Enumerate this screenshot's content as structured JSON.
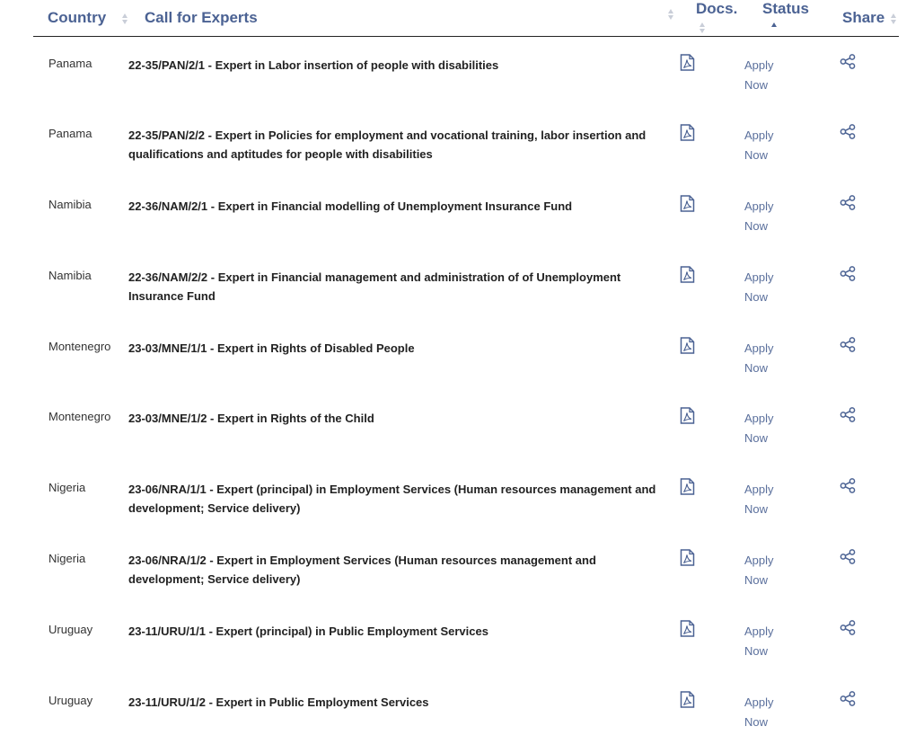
{
  "header": {
    "country": "Country",
    "call": "Call for Experts",
    "docs": "Docs.",
    "status": "Status",
    "share": "Share"
  },
  "colors": {
    "header": "#4b6293",
    "link": "#5a6f9c",
    "icon": "#4b6293"
  },
  "icons": {
    "doc": "pdf-file-icon",
    "share": "share-icon"
  },
  "rows": [
    {
      "country": "Panama",
      "call": "22-35/PAN/2/1 - Expert in Labor insertion of people with disabilities",
      "status": "Apply Now"
    },
    {
      "country": "Panama",
      "call": "22-35/PAN/2/2 - Expert in Policies for employment and vocational training, labor insertion and qualifications and aptitudes for people with disabilities",
      "status": "Apply Now"
    },
    {
      "country": "Namibia",
      "call": "22-36/NAM/2/1 - Expert in Financial modelling of Unemployment Insurance Fund",
      "status": "Apply Now"
    },
    {
      "country": "Namibia",
      "call": "22-36/NAM/2/2 - Expert in Financial management and administration of of Unemployment Insurance Fund",
      "status": "Apply Now"
    },
    {
      "country": "Montenegro",
      "call": "23-03/MNE/1/1 - Expert in Rights of Disabled People",
      "status": "Apply Now"
    },
    {
      "country": "Montenegro",
      "call": "23-03/MNE/1/2 - Expert in Rights of the Child",
      "status": "Apply Now"
    },
    {
      "country": "Nigeria",
      "call": "23-06/NRA/1/1 - Expert (principal) in Employment Services (Human resources management and development; Service delivery)",
      "status": "Apply Now"
    },
    {
      "country": "Nigeria",
      "call": "23-06/NRA/1/2 - Expert in Employment Services (Human resources management and development; Service delivery)",
      "status": "Apply Now"
    },
    {
      "country": "Uruguay",
      "call": "23-11/URU/1/1 - Expert (principal) in Public Employment Services",
      "status": "Apply Now"
    },
    {
      "country": "Uruguay",
      "call": "23-11/URU/1/2 - Expert in Public Employment Services",
      "status": "Apply Now"
    }
  ]
}
